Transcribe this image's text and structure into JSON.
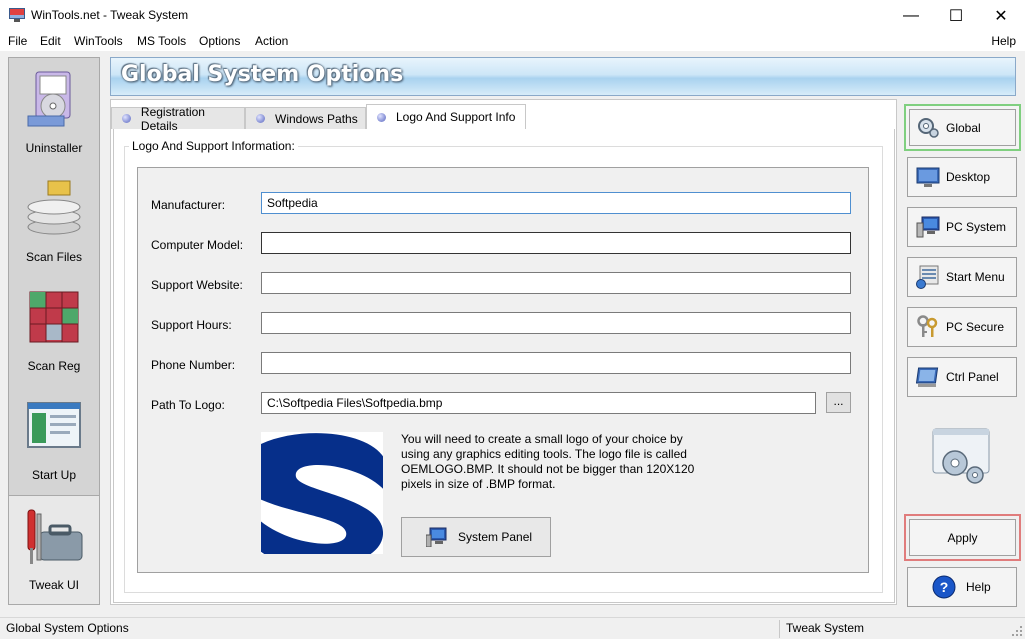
{
  "window": {
    "title": "WinTools.net - Tweak System",
    "minimize_glyph": "—",
    "maximize_glyph": "☐",
    "close_glyph": "✕"
  },
  "menu": {
    "items": [
      "File",
      "Edit",
      "WinTools",
      "MS Tools",
      "Options",
      "Action"
    ],
    "help": "Help"
  },
  "sidebar": {
    "items": [
      {
        "label": "Uninstaller",
        "icon": "uninstaller-icon"
      },
      {
        "label": "Scan Files",
        "icon": "scan-files-icon"
      },
      {
        "label": "Scan Reg",
        "icon": "scan-reg-icon"
      },
      {
        "label": "Start Up",
        "icon": "start-up-icon"
      },
      {
        "label": "Tweak UI",
        "icon": "tweak-ui-icon"
      }
    ],
    "active_index": 4
  },
  "header": {
    "title": "Global System Options"
  },
  "tabs": [
    {
      "label": "Registration Details"
    },
    {
      "label": "Windows Paths"
    },
    {
      "label": "Logo And Support Info"
    }
  ],
  "active_tab": 2,
  "group": {
    "title": "Logo And Support Information:"
  },
  "fields": {
    "manufacturer": {
      "label": "Manufacturer:",
      "value": "Softpedia"
    },
    "computer_model": {
      "label": "Computer Model:",
      "value": ""
    },
    "support_website": {
      "label": "Support Website:",
      "value": ""
    },
    "support_hours": {
      "label": "Support Hours:",
      "value": ""
    },
    "phone_number": {
      "label": "Phone Number:",
      "value": ""
    },
    "path_to_logo": {
      "label": "Path To Logo:",
      "value": "C:\\Softpedia Files\\Softpedia.bmp"
    }
  },
  "browse_label": "...",
  "logo_info": "You will need to create a small logo of your choice by using any graphics editing tools. The logo file is called OEMLOGO.BMP. It should not be bigger than 120X120 pixels in size of .BMP format.",
  "system_panel_label": "System Panel",
  "right_buttons": [
    {
      "label": "Global",
      "icon": "global-gear-icon"
    },
    {
      "label": "Desktop",
      "icon": "desktop-icon"
    },
    {
      "label": "PC System",
      "icon": "pc-system-icon"
    },
    {
      "label": "Start Menu",
      "icon": "start-menu-icon"
    },
    {
      "label": "PC Secure",
      "icon": "pc-secure-icon"
    },
    {
      "label": "Ctrl Panel",
      "icon": "ctrl-panel-icon"
    }
  ],
  "apply_label": "Apply",
  "help_label": "Help",
  "status": {
    "left": "Global System Options",
    "right": "Tweak System"
  }
}
